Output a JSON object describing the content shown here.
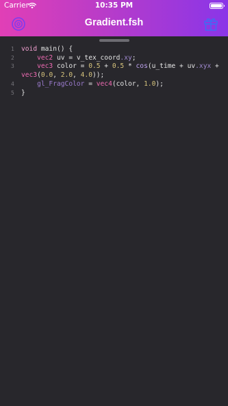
{
  "status_bar": {
    "carrier": "Carrier",
    "time": "10:35 PM"
  },
  "header": {
    "title": "Gradient.fsh",
    "left_icon": "settings-gear-icon",
    "right_icon": "gift-icon",
    "gradient": [
      "#e13fb6",
      "#8a35e8"
    ]
  },
  "editor": {
    "background": "#28272c",
    "lines": [
      {
        "number": "1",
        "tokens": [
          {
            "t": "void",
            "c": "kw"
          },
          {
            "t": " main() {",
            "c": ""
          }
        ]
      },
      {
        "number": "2",
        "tokens": [
          {
            "t": "    ",
            "c": ""
          },
          {
            "t": "vec2",
            "c": "ty"
          },
          {
            "t": " uv = v_tex_coord",
            "c": ""
          },
          {
            "t": ".xy",
            "c": "sw"
          },
          {
            "t": ";",
            "c": ""
          }
        ]
      },
      {
        "number": "3",
        "tokens": [
          {
            "t": "    ",
            "c": ""
          },
          {
            "t": "vec3",
            "c": "ty"
          },
          {
            "t": " color = ",
            "c": ""
          },
          {
            "t": "0.5",
            "c": "num"
          },
          {
            "t": " + ",
            "c": ""
          },
          {
            "t": "0.5",
            "c": "num"
          },
          {
            "t": " * ",
            "c": ""
          },
          {
            "t": "cos",
            "c": "fn"
          },
          {
            "t": "(u_time + uv",
            "c": ""
          },
          {
            "t": ".xyx",
            "c": "sw"
          },
          {
            "t": " +",
            "c": ""
          }
        ]
      },
      {
        "number": "",
        "tokens": [
          {
            "t": "vec3",
            "c": "ty"
          },
          {
            "t": "(",
            "c": ""
          },
          {
            "t": "0.0",
            "c": "num"
          },
          {
            "t": ", ",
            "c": ""
          },
          {
            "t": "2.0",
            "c": "num"
          },
          {
            "t": ", ",
            "c": ""
          },
          {
            "t": "4.0",
            "c": "num"
          },
          {
            "t": "));",
            "c": ""
          }
        ]
      },
      {
        "number": "4",
        "tokens": [
          {
            "t": "    ",
            "c": ""
          },
          {
            "t": "gl_FragColor",
            "c": "gv"
          },
          {
            "t": " = ",
            "c": ""
          },
          {
            "t": "vec4",
            "c": "ty"
          },
          {
            "t": "(color, ",
            "c": ""
          },
          {
            "t": "1.0",
            "c": "num"
          },
          {
            "t": ");",
            "c": ""
          }
        ]
      },
      {
        "number": "5",
        "tokens": [
          {
            "t": "}",
            "c": ""
          }
        ]
      }
    ]
  }
}
